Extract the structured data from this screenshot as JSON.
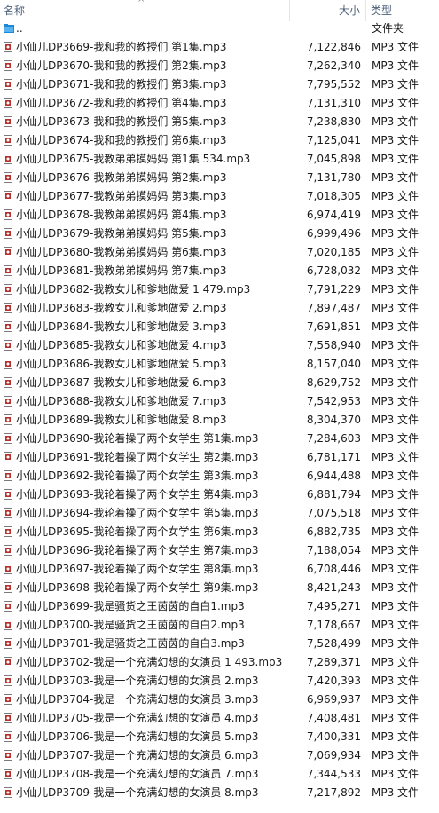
{
  "header": {
    "name_label": "名称",
    "size_label": "大小",
    "type_label": "类型",
    "sort_icon": "chevron-up-icon"
  },
  "parent": {
    "name": "..",
    "type": "文件夹"
  },
  "files": [
    {
      "name": "小仙儿DP3669-我和我的教授们 第1集.mp3",
      "size": "7,122,846",
      "type": "MP3 文件"
    },
    {
      "name": "小仙儿DP3670-我和我的教授们 第2集.mp3",
      "size": "7,262,340",
      "type": "MP3 文件"
    },
    {
      "name": "小仙儿DP3671-我和我的教授们 第3集.mp3",
      "size": "7,795,552",
      "type": "MP3 文件"
    },
    {
      "name": "小仙儿DP3672-我和我的教授们 第4集.mp3",
      "size": "7,131,310",
      "type": "MP3 文件"
    },
    {
      "name": "小仙儿DP3673-我和我的教授们 第5集.mp3",
      "size": "7,238,830",
      "type": "MP3 文件"
    },
    {
      "name": "小仙儿DP3674-我和我的教授们 第6集.mp3",
      "size": "7,125,041",
      "type": "MP3 文件"
    },
    {
      "name": "小仙儿DP3675-我教弟弟摸妈妈 第1集 534.mp3",
      "size": "7,045,898",
      "type": "MP3 文件"
    },
    {
      "name": "小仙儿DP3676-我教弟弟摸妈妈 第2集.mp3",
      "size": "7,131,780",
      "type": "MP3 文件"
    },
    {
      "name": "小仙儿DP3677-我教弟弟摸妈妈 第3集.mp3",
      "size": "7,018,305",
      "type": "MP3 文件"
    },
    {
      "name": "小仙儿DP3678-我教弟弟摸妈妈 第4集.mp3",
      "size": "6,974,419",
      "type": "MP3 文件"
    },
    {
      "name": "小仙儿DP3679-我教弟弟摸妈妈 第5集.mp3",
      "size": "6,999,496",
      "type": "MP3 文件"
    },
    {
      "name": "小仙儿DP3680-我教弟弟摸妈妈 第6集.mp3",
      "size": "7,020,185",
      "type": "MP3 文件"
    },
    {
      "name": "小仙儿DP3681-我教弟弟摸妈妈 第7集.mp3",
      "size": "6,728,032",
      "type": "MP3 文件"
    },
    {
      "name": "小仙儿DP3682-我教女儿和爹地做爱 1 479.mp3",
      "size": "7,791,229",
      "type": "MP3 文件"
    },
    {
      "name": "小仙儿DP3683-我教女儿和爹地做爱 2.mp3",
      "size": "7,897,487",
      "type": "MP3 文件"
    },
    {
      "name": "小仙儿DP3684-我教女儿和爹地做爱 3.mp3",
      "size": "7,691,851",
      "type": "MP3 文件"
    },
    {
      "name": "小仙儿DP3685-我教女儿和爹地做爱 4.mp3",
      "size": "7,558,940",
      "type": "MP3 文件"
    },
    {
      "name": "小仙儿DP3686-我教女儿和爹地做爱 5.mp3",
      "size": "8,157,040",
      "type": "MP3 文件"
    },
    {
      "name": "小仙儿DP3687-我教女儿和爹地做爱 6.mp3",
      "size": "8,629,752",
      "type": "MP3 文件"
    },
    {
      "name": "小仙儿DP3688-我教女儿和爹地做爱 7.mp3",
      "size": "7,542,953",
      "type": "MP3 文件"
    },
    {
      "name": "小仙儿DP3689-我教女儿和爹地做爱 8.mp3",
      "size": "8,304,370",
      "type": "MP3 文件"
    },
    {
      "name": "小仙儿DP3690-我轮着操了两个女学生 第1集.mp3",
      "size": "7,284,603",
      "type": "MP3 文件"
    },
    {
      "name": "小仙儿DP3691-我轮着操了两个女学生 第2集.mp3",
      "size": "6,781,171",
      "type": "MP3 文件"
    },
    {
      "name": "小仙儿DP3692-我轮着操了两个女学生 第3集.mp3",
      "size": "6,944,488",
      "type": "MP3 文件"
    },
    {
      "name": "小仙儿DP3693-我轮着操了两个女学生 第4集.mp3",
      "size": "6,881,794",
      "type": "MP3 文件"
    },
    {
      "name": "小仙儿DP3694-我轮着操了两个女学生 第5集.mp3",
      "size": "7,075,518",
      "type": "MP3 文件"
    },
    {
      "name": "小仙儿DP3695-我轮着操了两个女学生 第6集.mp3",
      "size": "6,882,735",
      "type": "MP3 文件"
    },
    {
      "name": "小仙儿DP3696-我轮着操了两个女学生 第7集.mp3",
      "size": "7,188,054",
      "type": "MP3 文件"
    },
    {
      "name": "小仙儿DP3697-我轮着操了两个女学生 第8集.mp3",
      "size": "6,708,446",
      "type": "MP3 文件"
    },
    {
      "name": "小仙儿DP3698-我轮着操了两个女学生 第9集.mp3",
      "size": "8,421,243",
      "type": "MP3 文件"
    },
    {
      "name": "小仙儿DP3699-我是骚货之王茵茵的自白1.mp3",
      "size": "7,495,271",
      "type": "MP3 文件"
    },
    {
      "name": "小仙儿DP3700-我是骚货之王茵茵的自白2.mp3",
      "size": "7,178,667",
      "type": "MP3 文件"
    },
    {
      "name": "小仙儿DP3701-我是骚货之王茵茵的自白3.mp3",
      "size": "7,528,499",
      "type": "MP3 文件"
    },
    {
      "name": "小仙儿DP3702-我是一个充满幻想的女演员 1 493.mp3",
      "size": "7,289,371",
      "type": "MP3 文件"
    },
    {
      "name": "小仙儿DP3703-我是一个充满幻想的女演员 2.mp3",
      "size": "7,420,393",
      "type": "MP3 文件"
    },
    {
      "name": "小仙儿DP3704-我是一个充满幻想的女演员 3.mp3",
      "size": "6,969,937",
      "type": "MP3 文件"
    },
    {
      "name": "小仙儿DP3705-我是一个充满幻想的女演员 4.mp3",
      "size": "7,408,481",
      "type": "MP3 文件"
    },
    {
      "name": "小仙儿DP3706-我是一个充满幻想的女演员 5.mp3",
      "size": "7,400,331",
      "type": "MP3 文件"
    },
    {
      "name": "小仙儿DP3707-我是一个充满幻想的女演员 6.mp3",
      "size": "7,069,934",
      "type": "MP3 文件"
    },
    {
      "name": "小仙儿DP3708-我是一个充满幻想的女演员 7.mp3",
      "size": "7,344,533",
      "type": "MP3 文件"
    },
    {
      "name": "小仙儿DP3709-我是一个充满幻想的女演员 8.mp3",
      "size": "7,217,892",
      "type": "MP3 文件"
    }
  ]
}
